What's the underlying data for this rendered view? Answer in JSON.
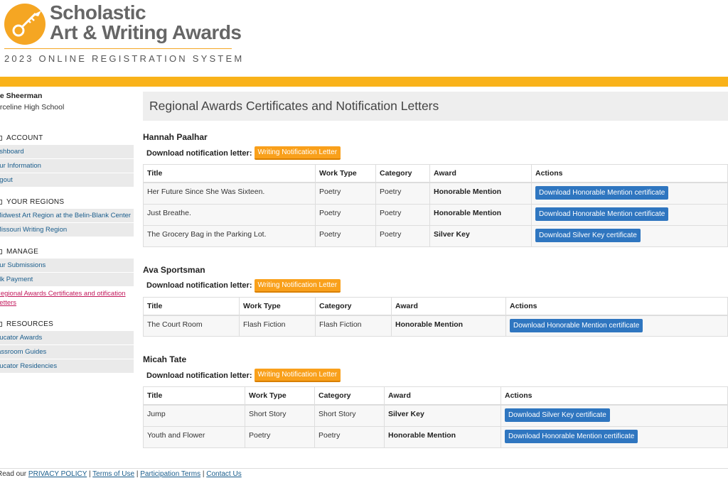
{
  "header": {
    "logo_line1": "Scholastic",
    "logo_line2": "Art & Writing Awards",
    "tagline": "2023 ONLINE REGISTRATION SYSTEM",
    "accent_color": "#f9b21a"
  },
  "sidebar": {
    "user_name": "lie Sheerman",
    "user_school": "arceline High School",
    "sections": [
      {
        "title": "ACCOUNT",
        "items": [
          "ashboard",
          "our Information",
          "ogout"
        ]
      },
      {
        "title": "YOUR REGIONS",
        "items": [
          "Midwest Art Region at the Belin-Blank Center",
          "Missouri Writing Region"
        ]
      },
      {
        "title": "MANAGE",
        "items": [
          "our Submissions",
          "ulk Payment",
          "Regional Awards Certificates and otification Letters"
        ]
      },
      {
        "title": "RESOURCES",
        "items": [
          "ducator Awards",
          "lassroom Guides",
          "ducator Residencies"
        ]
      }
    ]
  },
  "main": {
    "title": "Regional Awards Certificates and Notification Letters",
    "notif_label": "Download notification letter:",
    "letter_button": "Writing Notification Letter",
    "columns": [
      "Title",
      "Work Type",
      "Category",
      "Award",
      "Actions"
    ],
    "students": [
      {
        "name": "Hannah Paalhar",
        "rows": [
          {
            "title": "Her Future Since She Was Sixteen.",
            "work_type": "Poetry",
            "category": "Poetry",
            "award": "Honorable Mention",
            "action": "Download Honorable Mention certificate"
          },
          {
            "title": "Just Breathe.",
            "work_type": "Poetry",
            "category": "Poetry",
            "award": "Honorable Mention",
            "action": "Download Honorable Mention certificate"
          },
          {
            "title": "The Grocery Bag in the Parking Lot.",
            "work_type": "Poetry",
            "category": "Poetry",
            "award": "Silver Key",
            "action": "Download Silver Key certificate"
          }
        ]
      },
      {
        "name": "Ava Sportsman",
        "rows": [
          {
            "title": "The Court Room",
            "work_type": "Flash Fiction",
            "category": "Flash Fiction",
            "award": "Honorable Mention",
            "action": "Download Honorable Mention certificate"
          }
        ]
      },
      {
        "name": "Micah Tate",
        "rows": [
          {
            "title": "Jump",
            "work_type": "Short Story",
            "category": "Short Story",
            "award": "Silver Key",
            "action": "Download Silver Key certificate"
          },
          {
            "title": "Youth and Flower",
            "work_type": "Poetry",
            "category": "Poetry",
            "award": "Honorable Mention",
            "action": "Download Honorable Mention certificate"
          }
        ]
      }
    ]
  },
  "footer": {
    "prefix": "Read our ",
    "privacy": "PRIVACY POLICY",
    "sep": " | ",
    "terms": "Terms of Use",
    "participation": "Participation Terms",
    "contact": "Contact Us"
  }
}
